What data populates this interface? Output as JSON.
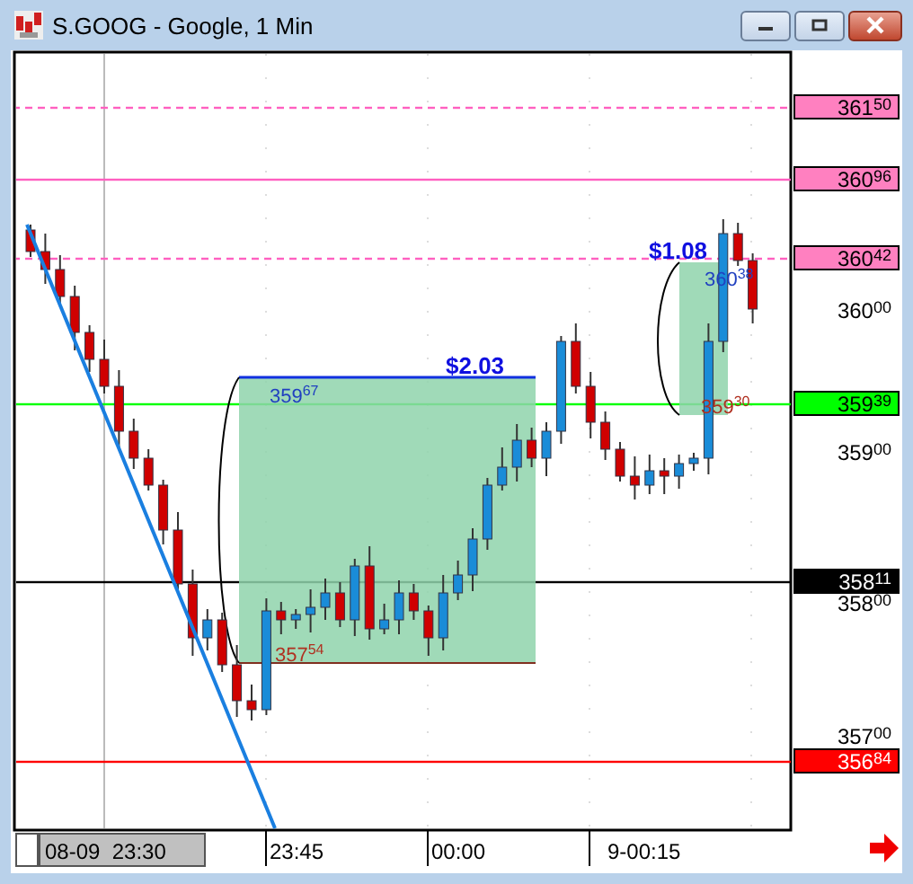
{
  "window": {
    "title": "S.GOOG - Google, 1 Min"
  },
  "price_axis": [
    {
      "label": "361$^{50}$",
      "kind": "marker",
      "color": "#ff80c0",
      "dashed": true
    },
    {
      "label": "360$^{96}$",
      "kind": "marker",
      "color": "#ff80c0",
      "dashed": false
    },
    {
      "label": "360$^{42}$",
      "kind": "marker",
      "color": "#ff80c0",
      "dashed": true
    },
    {
      "label": "360$^{00}$",
      "kind": "tick"
    },
    {
      "label": "359$^{39}$",
      "kind": "marker",
      "color": "#00ff00",
      "dashed": false
    },
    {
      "label": "359$^{00}$",
      "kind": "tick"
    },
    {
      "label": "358$^{11}$",
      "kind": "marker",
      "color": "#000000",
      "dashed": false
    },
    {
      "label": "358$^{00}$",
      "kind": "tick"
    },
    {
      "label": "357$^{00}$",
      "kind": "tick"
    },
    {
      "label": "356$^{84}$",
      "kind": "marker",
      "color": "#ff0000",
      "dashed": false
    }
  ],
  "time_axis": [
    {
      "label": "08-09  23:30",
      "kind": "start"
    },
    {
      "label": "23:45",
      "kind": "tick"
    },
    {
      "label": "00:00",
      "kind": "tick"
    },
    {
      "label": "9-00:15",
      "kind": "tick"
    }
  ],
  "annotations": [
    {
      "text": "$2.03",
      "kind": "gain"
    },
    {
      "text": "359$^{67}$",
      "kind": "high"
    },
    {
      "text": "357$^{54}$",
      "kind": "low"
    },
    {
      "text": "$1.08",
      "kind": "gain"
    },
    {
      "text": "360$^{38}$",
      "kind": "high"
    },
    {
      "text": "359$^{30}$",
      "kind": "low"
    }
  ]
}
